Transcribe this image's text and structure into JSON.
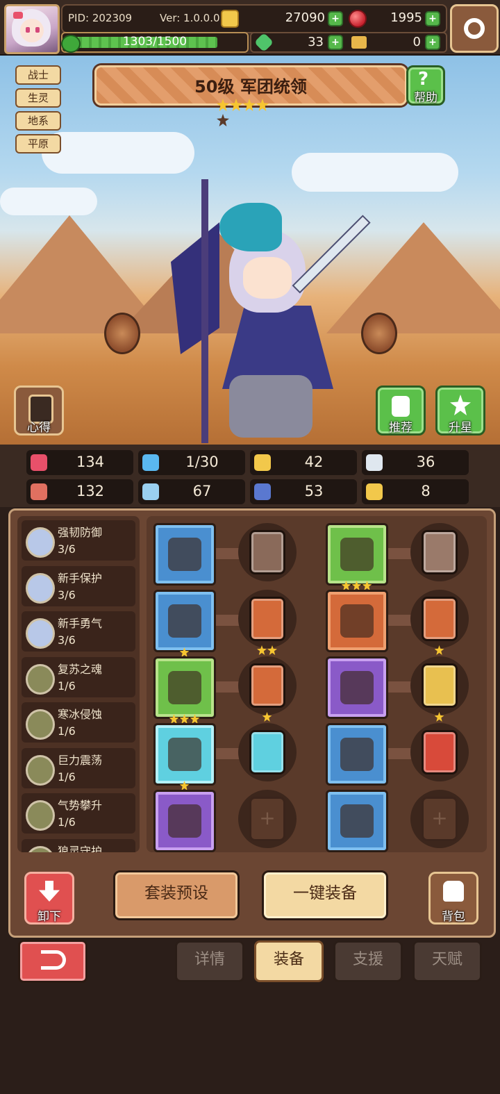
{
  "header": {
    "pid": "PID: 202309",
    "version": "Ver: 1.0.0.0",
    "gold": "27090",
    "gems": "1995",
    "xp": "1303/1500",
    "xp_progress": 0.869,
    "clover": "33",
    "keys": "0"
  },
  "hero": {
    "title": "50级  军团统领",
    "stars_filled": 4,
    "stars_total": 5,
    "tags": [
      "战士",
      "生灵",
      "地系",
      "平原"
    ],
    "help_label": "帮助",
    "insight_label": "心得",
    "recommend_label": "推荐",
    "upgrade_label": "升星"
  },
  "stats": [
    {
      "icon": "heart-icon",
      "color": "#e8506a",
      "value": "134"
    },
    {
      "icon": "water-drop-icon",
      "color": "#5ab8f0",
      "value": "1/30"
    },
    {
      "icon": "shield-icon",
      "color": "#f2c84b",
      "value": "42"
    },
    {
      "icon": "wing-icon",
      "color": "#dfe7ef",
      "value": "36"
    },
    {
      "icon": "fist-icon",
      "color": "#e07060",
      "value": "132"
    },
    {
      "icon": "book-icon",
      "color": "#9ad0f0",
      "value": "67"
    },
    {
      "icon": "boot-icon",
      "color": "#5a78d0",
      "value": "53"
    },
    {
      "icon": "horseshoe-icon",
      "color": "#f2c84b",
      "value": "8"
    }
  ],
  "sets": [
    {
      "name": "强韧防御",
      "count": "3/6",
      "color": "#b8c8e8"
    },
    {
      "name": "新手保护",
      "count": "3/6",
      "color": "#b8c8e8"
    },
    {
      "name": "新手勇气",
      "count": "3/6",
      "color": "#b8c8e8"
    },
    {
      "name": "复苏之魂",
      "count": "1/6",
      "color": "#8a8a5a"
    },
    {
      "name": "寒冰侵蚀",
      "count": "1/6",
      "color": "#8a8a5a"
    },
    {
      "name": "巨力震荡",
      "count": "1/6",
      "color": "#8a8a5a"
    },
    {
      "name": "气势攀升",
      "count": "1/6",
      "color": "#8a8a5a"
    },
    {
      "name": "狼灵守护",
      "count": "",
      "color": "#8a8a5a"
    }
  ],
  "equipment": [
    {
      "slot": "hammer",
      "rarity": "blue",
      "stars": 0,
      "rune": "#8a6a5a",
      "rune_stars": 0
    },
    {
      "slot": "hood",
      "rarity": "green",
      "stars": 3,
      "rune": "#9a7a6a",
      "rune_stars": 0
    },
    {
      "slot": "shield",
      "rarity": "blue",
      "stars": 1,
      "rune": "#d46a3a",
      "rune_stars": 2
    },
    {
      "slot": "armor",
      "rarity": "orange",
      "stars": 0,
      "rune": "#d46a3a",
      "rune_stars": 1
    },
    {
      "slot": "necklace",
      "rarity": "green",
      "stars": 3,
      "rune": "#d46a3a",
      "rune_stars": 1
    },
    {
      "slot": "gauntlet",
      "rarity": "purple",
      "stars": 0,
      "rune": "#e8c050",
      "rune_stars": 1
    },
    {
      "slot": "gem",
      "rarity": "cyan",
      "stars": 1,
      "rune": "#5fd0e0",
      "rune_stars": 0
    },
    {
      "slot": "belt",
      "rarity": "blue",
      "stars": 0,
      "rune": "#d84a3a",
      "rune_stars": 0
    },
    {
      "slot": "ring",
      "rarity": "purple",
      "stars": 0,
      "rune": "",
      "rune_stars": 0
    },
    {
      "slot": "boots",
      "rarity": "blue",
      "stars": 0,
      "rune": "",
      "rune_stars": 0
    }
  ],
  "actions": {
    "unequip": "卸下",
    "preset": "套装预设",
    "auto_equip": "一键装备",
    "bag": "背包"
  },
  "tabs": [
    "详情",
    "装备",
    "支援",
    "天赋"
  ],
  "active_tab": 1
}
